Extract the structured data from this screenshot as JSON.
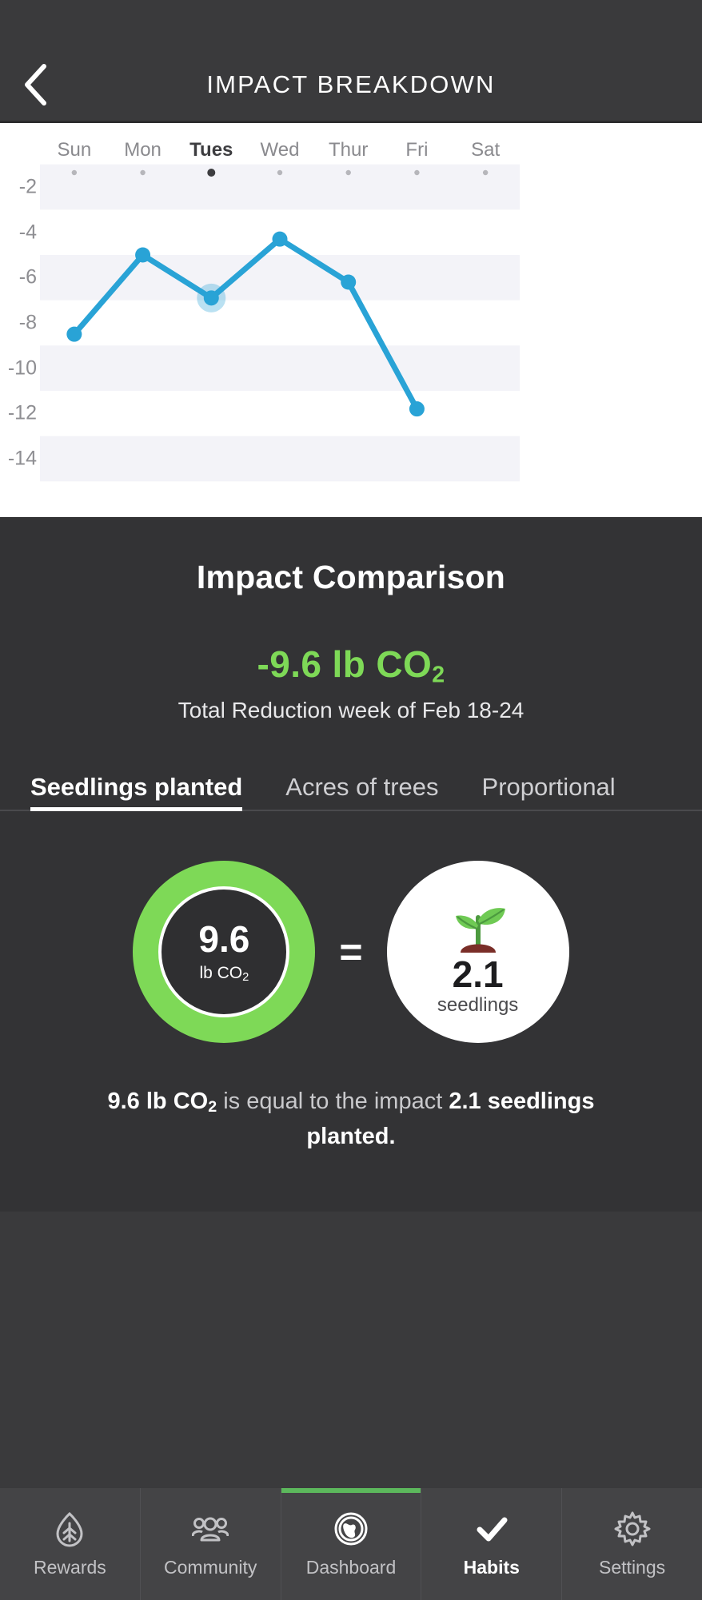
{
  "header": {
    "title": "IMPACT BREAKDOWN",
    "back_icon": "chevron-left-icon"
  },
  "chart_data": {
    "type": "line",
    "title": "",
    "xlabel": "",
    "ylabel": "",
    "categories": [
      "Sun",
      "Mon",
      "Tues",
      "Wed",
      "Thur",
      "Fri",
      "Sat"
    ],
    "values": [
      -8.5,
      -5.0,
      -6.9,
      -4.3,
      -6.2,
      -11.8,
      null
    ],
    "selected_category": "Tues",
    "selected_value": -6.9,
    "ytick_labels": [
      "-2",
      "-4",
      "-6",
      "-8",
      "-10",
      "-12",
      "-14"
    ],
    "ytick_values": [
      -2,
      -4,
      -6,
      -8,
      -10,
      -12,
      -14
    ],
    "ylim": [
      -15,
      -1
    ],
    "grid": "alternating-bands",
    "legend": "none",
    "line_color": "#29a3d6",
    "point_color": "#29a3d6",
    "band_color": "#f3f3f8",
    "background": "#ffffff"
  },
  "impact": {
    "title": "Impact Comparison",
    "value_prefix": "-9.6 lb CO",
    "value_sub": "2",
    "subtitle": "Total Reduction week of Feb 18-24",
    "value_color": "#7ed957"
  },
  "tabs": [
    {
      "label": "Seedlings planted",
      "active": true
    },
    {
      "label": "Acres of trees",
      "active": false
    },
    {
      "label": "Proportional",
      "active": false
    }
  ],
  "comparison": {
    "left": {
      "number": "9.6",
      "unit_prefix": "lb CO",
      "unit_sub": "2",
      "ring_color": "#7ed957"
    },
    "operator": "=",
    "right": {
      "icon": "seedling-icon",
      "number": "2.1",
      "unit": "seedlings"
    },
    "caption": {
      "bold_1": "9.6 lb CO",
      "bold_1_sub": "2",
      "mid": " is equal to the impact ",
      "bold_2": "2.1 seedlings planted."
    }
  },
  "navbar": [
    {
      "label": "Rewards",
      "icon": "leaf-drop-icon",
      "active": false,
      "indicator": false
    },
    {
      "label": "Community",
      "icon": "people-group-icon",
      "active": false,
      "indicator": false
    },
    {
      "label": "Dashboard",
      "icon": "globe-coin-icon",
      "active": false,
      "indicator": true
    },
    {
      "label": "Habits",
      "icon": "check-icon",
      "active": true,
      "indicator": false
    },
    {
      "label": "Settings",
      "icon": "gear-icon",
      "active": false,
      "indicator": false
    }
  ]
}
